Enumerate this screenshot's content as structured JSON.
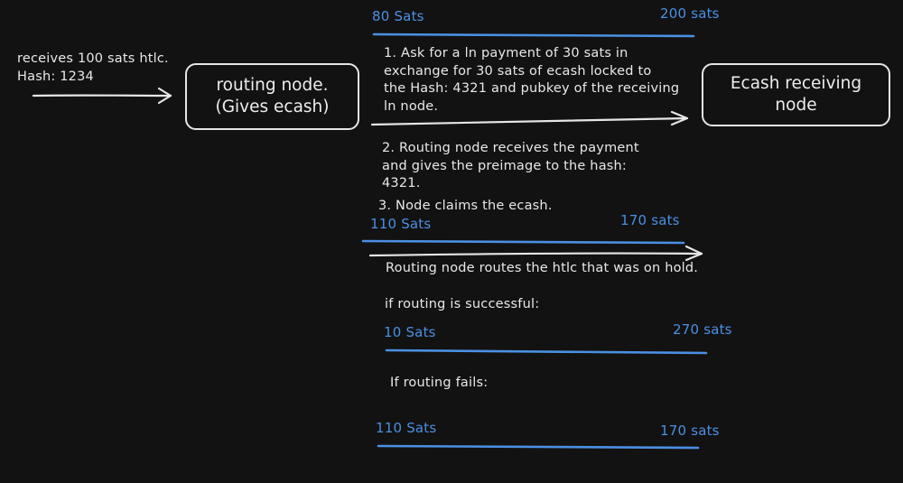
{
  "colors": {
    "background": "#121212",
    "text": "#e8e8e8",
    "balance_blue": "#4a90e2"
  },
  "incoming": {
    "label": "receives 100 sats htlc.\nHash: 1234"
  },
  "nodes": {
    "routing": "routing node.\n(Gives ecash)",
    "receiver": "Ecash receiving\nnode"
  },
  "channel_1": {
    "left": "80 Sats",
    "right": "200 sats"
  },
  "steps": {
    "step1": "1. Ask for a ln payment of 30 sats in\nexchange for 30 sats of ecash locked to\nthe Hash: 4321 and pubkey of the receiving\nln node.",
    "step2": "2. Routing node receives the payment\nand gives the preimage to the hash:\n4321.",
    "step3": "3. Node claims the ecash."
  },
  "channel_2": {
    "left": "110 Sats",
    "right": "170 sats"
  },
  "htlc_note": "Routing node routes the htlc that was on hold.",
  "success": {
    "label": "if routing is successful:",
    "left": "10 Sats",
    "right": "270 sats"
  },
  "failure": {
    "label": "If routing fails:",
    "left": "110 Sats",
    "right": "170 sats"
  }
}
